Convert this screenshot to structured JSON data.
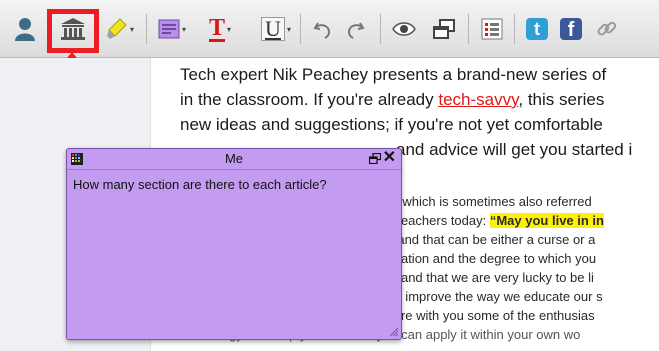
{
  "toolbar": {
    "icons": [
      "user-icon",
      "library-icon",
      "highlighter-icon",
      "sticky-note-icon",
      "text-color-icon",
      "underline-icon",
      "undo-icon",
      "redo-icon",
      "eye-icon",
      "windows-icon",
      "list-icon",
      "twitter-icon",
      "facebook-icon",
      "link-icon"
    ],
    "text_color_glyph": "T",
    "underline_glyph": "U",
    "twitter_glyph": "t",
    "facebook_glyph": "f"
  },
  "colors": {
    "annotation_red": "#ec1c24",
    "note_bg": "#c39cf1",
    "link": "#e0191b",
    "highlight": "#fff200"
  },
  "article": {
    "para1": {
      "line1": "Tech expert Nik Peachey presents a brand-new series of",
      "line2_before": "in the classroom. If you're already ",
      "line2_link": "tech-savvy",
      "line2_after": ", this series",
      "line3": "new ideas and suggestions; if you're not yet comfortable",
      "line4": "and advice will get you started i"
    },
    "para2": {
      "line1": "erb which is sometimes also referred",
      "line2_before": "as teachers today: ",
      "line2_highlight": "“May you live in in",
      "line3": "es and that can be either a curse or a",
      "line4": "ducation and the degree to which you",
      "line5": "ing and that we are very lucky to be li",
      "line6": "and improve the way we educate our s",
      "line7": "share with you some of the enthusias",
      "line8": "technology and help you see how you can apply it within your own wo"
    }
  },
  "note": {
    "title": "Me",
    "body": "How many section are there to each article?"
  }
}
